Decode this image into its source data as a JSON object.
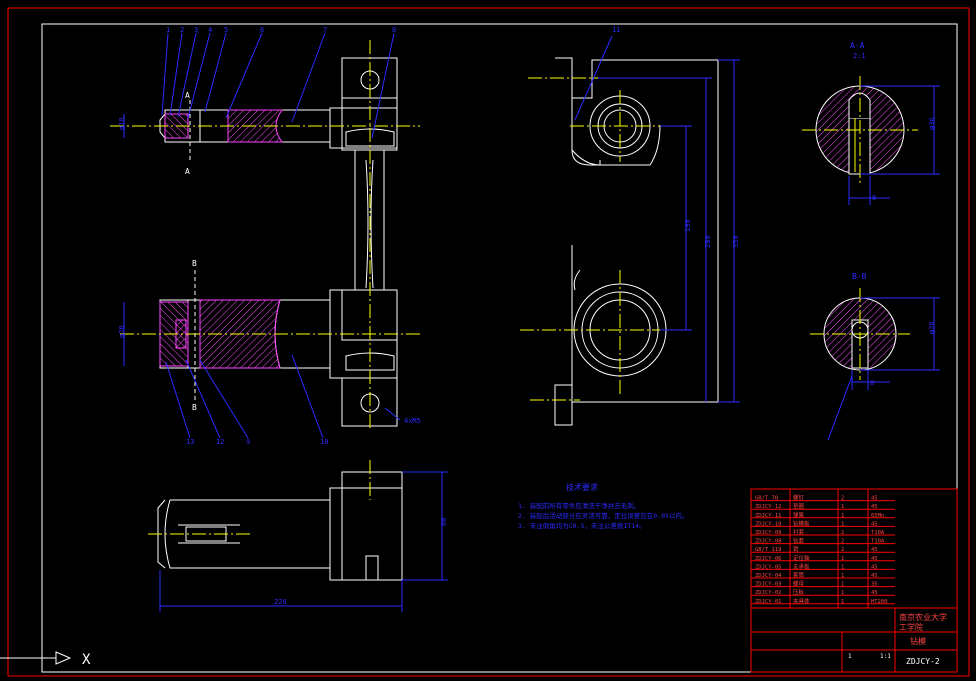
{
  "colors": {
    "background": "#000000",
    "frame": "#ffffff",
    "border": "#ff0000",
    "outline": "#ffffff",
    "centerline": "#ffff00",
    "leader": "#2b2bff",
    "dimension": "#2b2bff",
    "hatch": "#ff44ff",
    "titleblock": "#ff0000",
    "titletext": "#ff4444"
  },
  "section_labels": {
    "aa": "A-A",
    "aa_scale": "2:1",
    "bb": "B-B",
    "cut_a_top": "A",
    "cut_a_bottom": "A",
    "cut_b_top": "B",
    "cut_b_bottom": "B"
  },
  "part_numbers": [
    "1",
    "2",
    "3",
    "4",
    "5",
    "6",
    "7",
    "8",
    "9",
    "10",
    "11",
    "12",
    "13"
  ],
  "notes": {
    "heading": "技术要求",
    "lines": [
      "1. 装配前所有零件应清洗干净并去毛刺。",
      "2. 装配后活动部分应灵活可靠，定位误差应在0.05以内。",
      "3. 未注倒角均为C0.5，未注公差按IT14。"
    ]
  },
  "dimensions": {
    "left_top": "φ18",
    "left_bottom": "φ28",
    "thread": "4xM5",
    "overall_height": "350",
    "inner_height": "280",
    "center_span": "190",
    "bottom_length": "220",
    "bottom_height": "60",
    "aa_dia": "φ36",
    "aa_width": "8",
    "bb_dia": "φ26",
    "bb_width": "8"
  },
  "titleblock": {
    "school": "南京农业大学",
    "dept": "工学院",
    "name": "钻模",
    "drawing_no": "ZDJCY-2",
    "scale": "1:1",
    "sheet": "1",
    "rows": [
      [
        "13",
        "GB/T 70",
        "螺钉",
        "2",
        "45"
      ],
      [
        "12",
        "ZDJCY-12",
        "垫圈",
        "1",
        "45"
      ],
      [
        "11",
        "ZDJCY-11",
        "弹簧",
        "1",
        "65Mn"
      ],
      [
        "10",
        "ZDJCY-10",
        "钻模板",
        "1",
        "45"
      ],
      [
        "9",
        "ZDJCY-09",
        "衬套",
        "2",
        "T10A"
      ],
      [
        "8",
        "ZDJCY-08",
        "钻套",
        "2",
        "T10A"
      ],
      [
        "7",
        "GB/T 119",
        "销",
        "2",
        "45"
      ],
      [
        "6",
        "ZDJCY-06",
        "定位轴",
        "1",
        "45"
      ],
      [
        "5",
        "ZDJCY-05",
        "支承板",
        "1",
        "45"
      ],
      [
        "4",
        "ZDJCY-04",
        "套筒",
        "1",
        "45"
      ],
      [
        "3",
        "ZDJCY-03",
        "螺母",
        "1",
        "35"
      ],
      [
        "2",
        "ZDJCY-02",
        "压板",
        "1",
        "45"
      ],
      [
        "1",
        "ZDJCY-01",
        "夹具体",
        "1",
        "HT200"
      ]
    ]
  },
  "ucs": {
    "x_label": "X"
  }
}
